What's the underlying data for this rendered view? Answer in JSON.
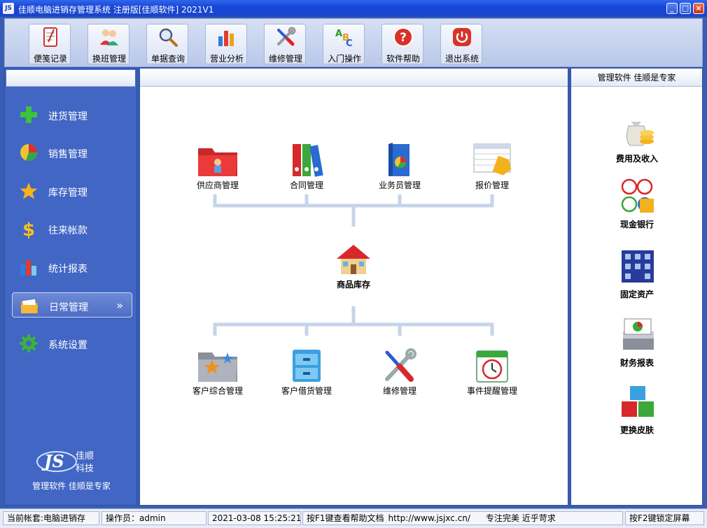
{
  "window": {
    "title": "佳顺电脑进销存管理系统 注册版[佳顺软件] 2021V1",
    "app_icon_text": "JS",
    "minimize_glyph": "_",
    "maximize_glyph": "□",
    "close_glyph": "×"
  },
  "toolbar": {
    "items": [
      {
        "label": "便笺记录",
        "icon": "notepad-icon"
      },
      {
        "label": "换班管理",
        "icon": "users-icon"
      },
      {
        "label": "单据查询",
        "icon": "magnifier-icon"
      },
      {
        "label": "营业分析",
        "icon": "bar-chart-icon"
      },
      {
        "label": "维修管理",
        "icon": "tools-icon"
      },
      {
        "label": "入门操作",
        "icon": "abc-icon"
      },
      {
        "label": "软件帮助",
        "icon": "help-icon"
      },
      {
        "label": "退出系统",
        "icon": "power-icon"
      }
    ]
  },
  "sidebar": {
    "items": [
      {
        "label": "进货管理",
        "icon": "plus-icon"
      },
      {
        "label": "销售管理",
        "icon": "pie-chart-icon"
      },
      {
        "label": "库存管理",
        "icon": "star-icon"
      },
      {
        "label": "往来帐款",
        "icon": "dollar-icon"
      },
      {
        "label": "统计报表",
        "icon": "bar-chart-icon"
      },
      {
        "label": "日常管理",
        "icon": "folder-icon",
        "active": true,
        "arrow": "»"
      },
      {
        "label": "系统设置",
        "icon": "gear-icon"
      }
    ],
    "brand": {
      "logo_text": "JS",
      "logo_name_line1": "佳顺",
      "logo_name_line2": "科技",
      "slogan": "管理软件 佳顺是专家"
    }
  },
  "main": {
    "top_row": [
      {
        "label": "供应商管理",
        "icon": "supplier-folder-icon"
      },
      {
        "label": "合同管理",
        "icon": "binders-icon"
      },
      {
        "label": "业务员管理",
        "icon": "book-icon"
      },
      {
        "label": "报价管理",
        "icon": "price-tag-icon"
      }
    ],
    "center": {
      "label": "商品库存",
      "icon": "house-icon"
    },
    "bottom_row": [
      {
        "label": "客户综合管理",
        "icon": "customer-folder-icon"
      },
      {
        "label": "客户借货管理",
        "icon": "file-cabinet-icon"
      },
      {
        "label": "维修管理",
        "icon": "tools-icon"
      },
      {
        "label": "事件提醒管理",
        "icon": "calendar-clock-icon"
      }
    ]
  },
  "right": {
    "header": "管理软件 佳顺是专家",
    "items": [
      {
        "label": "费用及收入",
        "icon": "money-bag-icon"
      },
      {
        "label": "现金银行",
        "icon": "bank-icon"
      },
      {
        "label": "固定资产",
        "icon": "building-icon"
      },
      {
        "label": "财务报表",
        "icon": "report-stack-icon"
      },
      {
        "label": "更换皮肤",
        "icon": "cubes-icon"
      }
    ]
  },
  "statusbar": {
    "account": "当前帐套:电脑进销存",
    "operator": "操作员：admin",
    "datetime": "2021-03-08 15:25:21",
    "help_hint": "按F1键查看帮助文档",
    "url": "http://www.jsjxc.cn/",
    "motto": "专注完美 近乎苛求",
    "lock_hint": "按F2键锁定屏幕"
  }
}
